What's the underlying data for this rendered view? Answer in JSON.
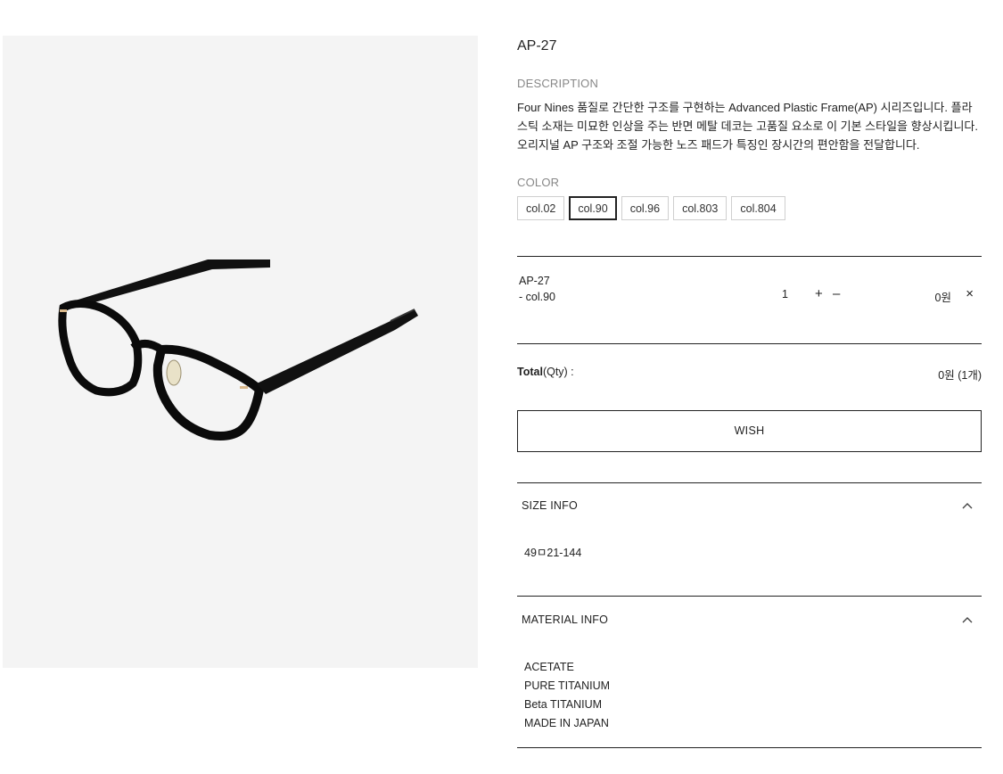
{
  "product": {
    "title": "AP-27",
    "description_label": "DESCRIPTION",
    "description": "Four Nines 품질로 간단한 구조를 구현하는 Advanced Plastic Frame(AP) 시리즈입니다. 플라스틱 소재는 미묘한 인상을 주는 반면 메탈 데코는 고품질 요소로 이 기본 스타일을 향상시킵니다. 오리지널 AP 구조와 조절 가능한 노즈 패드가 특징인 장시간의 편안함을 전달합니다.",
    "image_icon": "eyeglasses-icon"
  },
  "color": {
    "label": "COLOR",
    "options": [
      "col.02",
      "col.90",
      "col.96",
      "col.803",
      "col.804"
    ],
    "selected": "col.90"
  },
  "selection": {
    "name": "AP-27",
    "variant": "- col.90",
    "qty": "1",
    "plus": "+",
    "minus": "–",
    "price": "0원",
    "remove": "×"
  },
  "total": {
    "label_bold": "Total",
    "label_rest": "(Qty) :",
    "value": "0원 (1개)"
  },
  "wish_label": "WISH",
  "size_info": {
    "title": "SIZE INFO",
    "value": "49ㅁ21-144"
  },
  "material_info": {
    "title": "MATERIAL INFO",
    "items": [
      "ACETATE",
      "PURE TITANIUM",
      "Beta TITANIUM",
      "MADE IN JAPAN"
    ]
  },
  "colors": {
    "border": "#222222",
    "muted": "#888888",
    "image_bg": "#f4f4f4"
  }
}
